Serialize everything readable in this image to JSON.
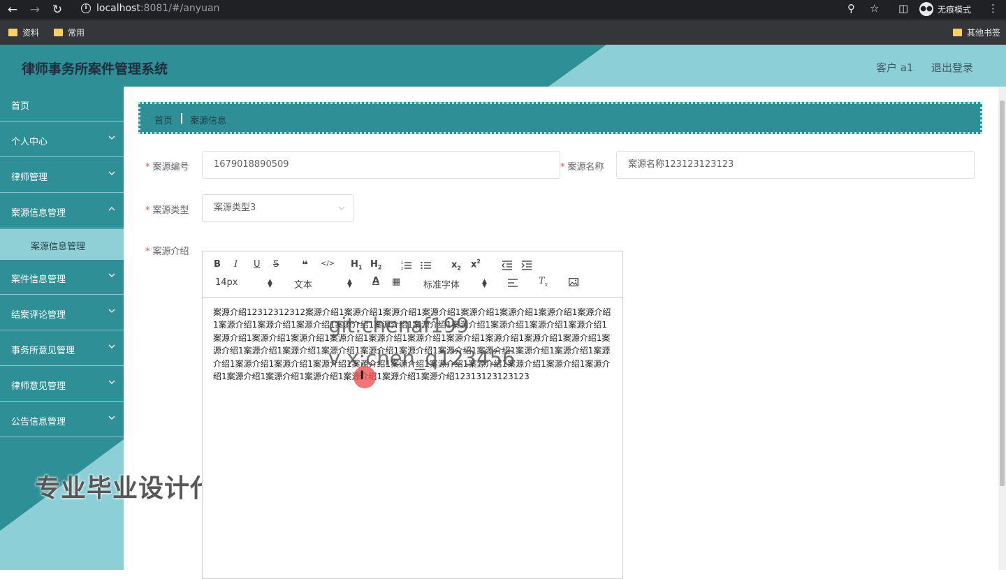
{
  "browser": {
    "url_host": "localhost",
    "url_rest": ":8081/#/anyuan",
    "incognito_label": "无痕模式",
    "bookmarks": [
      "资料",
      "常用"
    ],
    "other_bookmarks": "其他书签"
  },
  "header": {
    "title": "律师事务所案件管理系统",
    "user": "客户 a1",
    "logout": "退出登录"
  },
  "sidebar": {
    "items": [
      {
        "label": "首页",
        "has_chevron": false
      },
      {
        "label": "个人中心",
        "has_chevron": true
      },
      {
        "label": "律师管理",
        "has_chevron": true
      },
      {
        "label": "案源信息管理",
        "has_chevron": true
      },
      {
        "label": "案件信息管理",
        "has_chevron": true
      },
      {
        "label": "结案评论管理",
        "has_chevron": true
      },
      {
        "label": "事务所意见管理",
        "has_chevron": true
      },
      {
        "label": "律师意见管理",
        "has_chevron": true
      },
      {
        "label": "公告信息管理",
        "has_chevron": true
      }
    ],
    "active_sub": "案源信息管理",
    "promo": "专业毕业设计代做"
  },
  "breadcrumb": {
    "home": "首页",
    "current": "案源信息"
  },
  "form": {
    "code_label": "案源编号",
    "code_value": "1679018890509",
    "name_label": "案源名称",
    "name_value": "案源名称123123123123",
    "type_label": "案源类型",
    "type_value": "案源类型3",
    "intro_label": "案源介绍"
  },
  "editor": {
    "font_size": "14px",
    "header_pick": "文本",
    "font_family": "标准字体",
    "content": "案源介绍12312312312案源介绍1案源介绍1案源介绍1案源介绍1案源介绍1案源介绍1案源介绍1案源介绍1案源介绍1案源介绍1案源介绍1案源介绍1案源介绍1案源介绍1案源介绍1案源介绍1案源介绍1案源介绍1案源介绍1案源介绍1案源介绍1案源介绍1案源介绍1案源介绍1案源介绍1案源介绍1案源介绍1案源介绍1案源介绍1案源介绍1案源介绍1案源介绍1案源介绍1案源介绍1案源介绍1案源介绍1案源介绍1案源介绍1案源介绍1案源介绍1案源介绍1案源介绍1案源介绍1案源介绍1案源介绍1案源介绍1案源介绍1案源介绍1案源介绍1案源介绍1案源介绍1案源介绍1案源介绍1案源介绍1案源介绍12313123123123"
  },
  "watermark": {
    "line1": "git:chenaf199",
    "line2": "v x:chen_q123456"
  },
  "colors": {
    "teal": "#2f8f97",
    "light_teal": "#8fd0d6",
    "required_star": "#e74c3c"
  }
}
